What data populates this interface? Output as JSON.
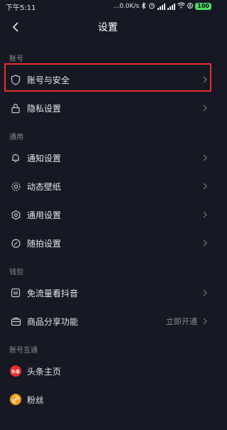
{
  "status_bar": {
    "time": "下午5:11",
    "network_speed": "...0.0K/s",
    "battery": "100"
  },
  "header": {
    "title": "设置"
  },
  "sections": [
    {
      "label": "账号",
      "items": [
        {
          "label": "账号与安全",
          "icon": "shield-icon"
        },
        {
          "label": "隐私设置",
          "icon": "lock-icon"
        }
      ]
    },
    {
      "label": "通用",
      "items": [
        {
          "label": "通知设置",
          "icon": "bell-icon"
        },
        {
          "label": "动态壁纸",
          "icon": "wallpaper-icon"
        },
        {
          "label": "通用设置",
          "icon": "gear-icon"
        },
        {
          "label": "随拍设置",
          "icon": "camera-icon"
        }
      ]
    },
    {
      "label": "钱包",
      "items": [
        {
          "label": "免流量看抖音",
          "icon": "data-free-icon"
        },
        {
          "label": "商品分享功能",
          "icon": "shop-icon",
          "extra": "立即开通"
        }
      ]
    },
    {
      "label": "账号互通",
      "items": [
        {
          "label": "头条主页",
          "icon": "toutiao-icon",
          "badge_text": "头条"
        },
        {
          "label": "粉丝",
          "icon": "fans-icon"
        }
      ]
    }
  ],
  "colors": {
    "background": "#161823",
    "highlight": "#e6312c",
    "battery": "#4cd964"
  }
}
